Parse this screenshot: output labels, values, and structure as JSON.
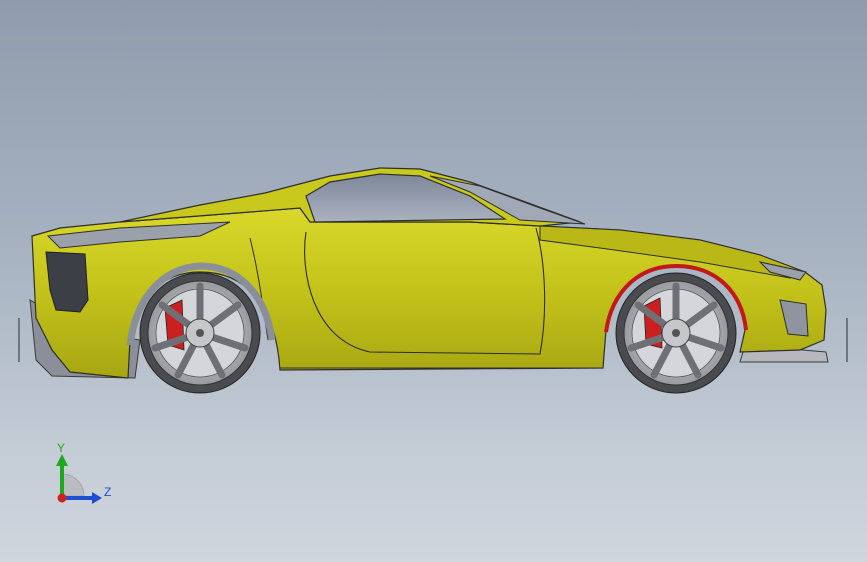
{
  "viewport": {
    "background_top": "#8f9cad",
    "background_bottom": "#d0d6de"
  },
  "model": {
    "body_color": "#c3c21a",
    "glass_color": "#9aa3b2",
    "caliper_color": "#cc2020",
    "wheel_color": "#b9babc"
  },
  "triad": {
    "y_label": "Y",
    "z_label": "Z",
    "y_color": "#1ea81e",
    "z_color": "#1f4fd1",
    "x_color": "#d11f1f"
  }
}
